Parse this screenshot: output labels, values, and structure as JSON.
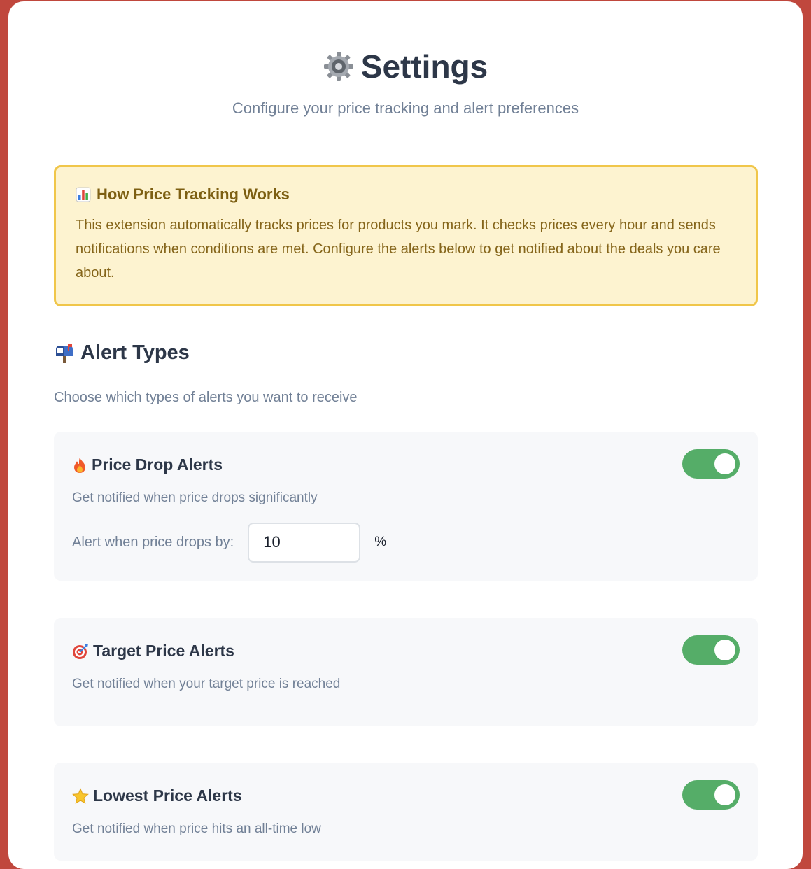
{
  "header": {
    "title": "Settings",
    "subtitle": "Configure your price tracking and alert preferences",
    "title_icon": "gear-icon"
  },
  "info": {
    "title": "How Price Tracking Works",
    "title_icon": "bar-chart-icon",
    "text": "This extension automatically tracks prices for products you mark. It checks prices every hour and sends notifications when conditions are met. Configure the alerts below to get notified about the deals you care about."
  },
  "alert_types": {
    "title": "Alert Types",
    "title_icon": "mailbox-icon",
    "description": "Choose which types of alerts you want to receive"
  },
  "alerts": [
    {
      "name": "Price Drop Alerts",
      "icon": "fire-icon",
      "description": "Get notified when price drops significantly",
      "enabled": true,
      "threshold_label": "Alert when price drops by:",
      "threshold_value": "10",
      "threshold_unit": "%"
    },
    {
      "name": "Target Price Alerts",
      "icon": "target-icon",
      "description": "Get notified when your target price is reached",
      "enabled": true
    },
    {
      "name": "Lowest Price Alerts",
      "icon": "star-icon",
      "description": "Get notified when price hits an all-time low",
      "enabled": true
    }
  ],
  "colors": {
    "page_background": "#c0473d",
    "toggle_on": "#55ad68",
    "info_background": "#fdf3d0",
    "info_border": "#f0c64a"
  }
}
